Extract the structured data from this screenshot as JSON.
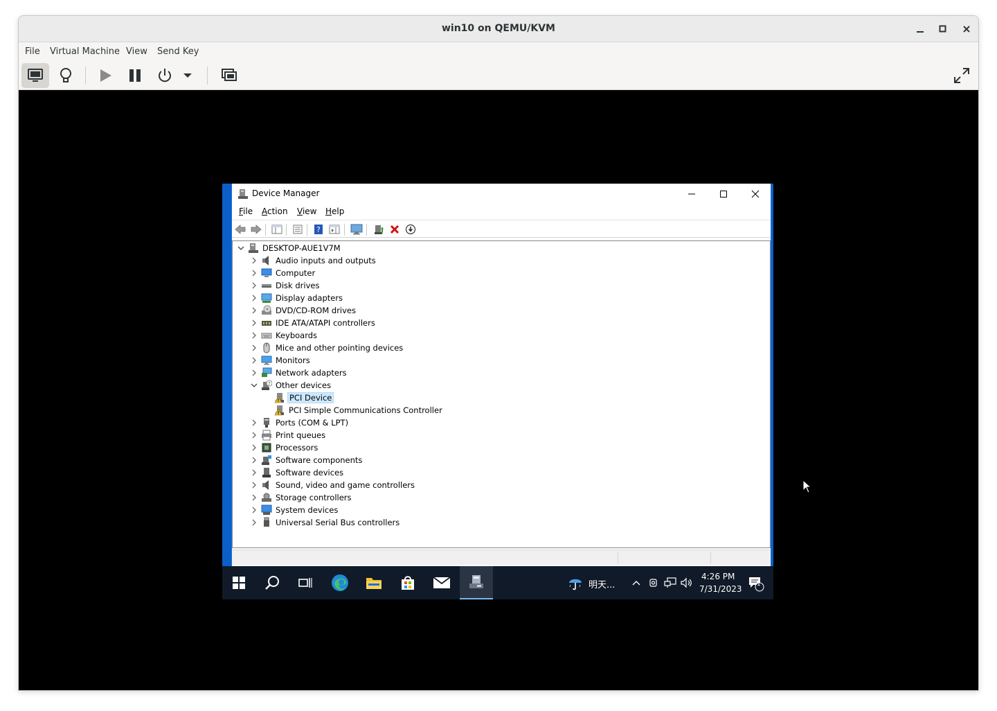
{
  "host_window": {
    "title": "win10 on QEMU/KVM",
    "controls": {
      "minimize": "–",
      "maximize": "□",
      "close": "✕"
    },
    "menu": [
      "File",
      "Virtual Machine",
      "View",
      "Send Key"
    ],
    "toolbar": {
      "buttons": [
        "console-view",
        "details-view",
        "run",
        "pause",
        "shutdown",
        "shutdown-menu",
        "snapshots",
        "fullscreen"
      ]
    }
  },
  "device_manager": {
    "title": "Device Manager",
    "controls": {
      "minimize": "—",
      "maximize": "☐",
      "close": "✕"
    },
    "menu": [
      {
        "label": "File",
        "accel": "F",
        "rest": "ile"
      },
      {
        "label": "Action",
        "accel": "A",
        "rest": "ction"
      },
      {
        "label": "View",
        "accel": "V",
        "rest": "iew"
      },
      {
        "label": "Help",
        "accel": "H",
        "rest": "elp"
      }
    ],
    "tree": {
      "root": "DESKTOP-AUE1V7M",
      "categories": [
        {
          "label": "Audio inputs and outputs",
          "icon": "speaker-icon"
        },
        {
          "label": "Computer",
          "icon": "computer-icon"
        },
        {
          "label": "Disk drives",
          "icon": "disk-icon"
        },
        {
          "label": "Display adapters",
          "icon": "display-adapter-icon"
        },
        {
          "label": "DVD/CD-ROM drives",
          "icon": "dvd-icon"
        },
        {
          "label": "IDE ATA/ATAPI controllers",
          "icon": "ide-icon"
        },
        {
          "label": "Keyboards",
          "icon": "keyboard-icon"
        },
        {
          "label": "Mice and other pointing devices",
          "icon": "mouse-icon"
        },
        {
          "label": "Monitors",
          "icon": "monitor-icon"
        },
        {
          "label": "Network adapters",
          "icon": "network-icon"
        },
        {
          "label": "Other devices",
          "icon": "other-devices-icon",
          "expanded": true,
          "children": [
            {
              "label": "PCI Device",
              "icon": "warning-device-icon",
              "selected": true
            },
            {
              "label": "PCI Simple Communications Controller",
              "icon": "warning-device-icon"
            }
          ]
        },
        {
          "label": "Ports (COM & LPT)",
          "icon": "port-icon"
        },
        {
          "label": "Print queues",
          "icon": "printer-icon"
        },
        {
          "label": "Processors",
          "icon": "processor-icon"
        },
        {
          "label": "Software components",
          "icon": "software-component-icon"
        },
        {
          "label": "Software devices",
          "icon": "software-device-icon"
        },
        {
          "label": "Sound, video and game controllers",
          "icon": "sound-icon"
        },
        {
          "label": "Storage controllers",
          "icon": "storage-icon"
        },
        {
          "label": "System devices",
          "icon": "system-icon"
        },
        {
          "label": "Universal Serial Bus controllers",
          "icon": "usb-icon"
        }
      ]
    }
  },
  "taskbar": {
    "weather_text": "明天...",
    "time": "4:26 PM",
    "date": "7/31/2023",
    "notification_count": "1"
  },
  "colors": {
    "guest_accent": "#0a5fc8",
    "taskbar": "#101a28",
    "selection": "#cce8ff"
  }
}
